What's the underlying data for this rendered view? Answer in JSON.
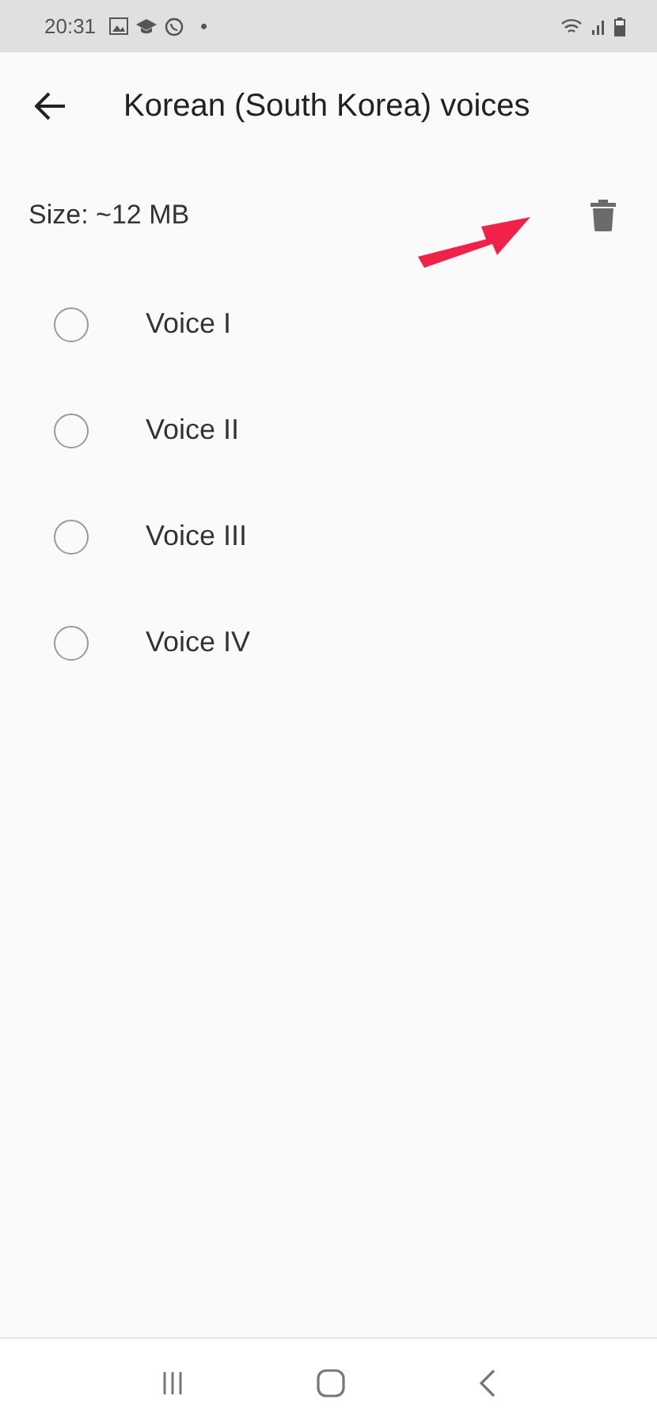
{
  "status_bar": {
    "time": "20:31",
    "dot": "•"
  },
  "header": {
    "title": "Korean (South Korea) voices"
  },
  "size": {
    "label": "Size: ~12 MB"
  },
  "voices": [
    {
      "label": "Voice I",
      "selected": false
    },
    {
      "label": "Voice II",
      "selected": false
    },
    {
      "label": "Voice III",
      "selected": false
    },
    {
      "label": "Voice IV",
      "selected": false
    }
  ]
}
